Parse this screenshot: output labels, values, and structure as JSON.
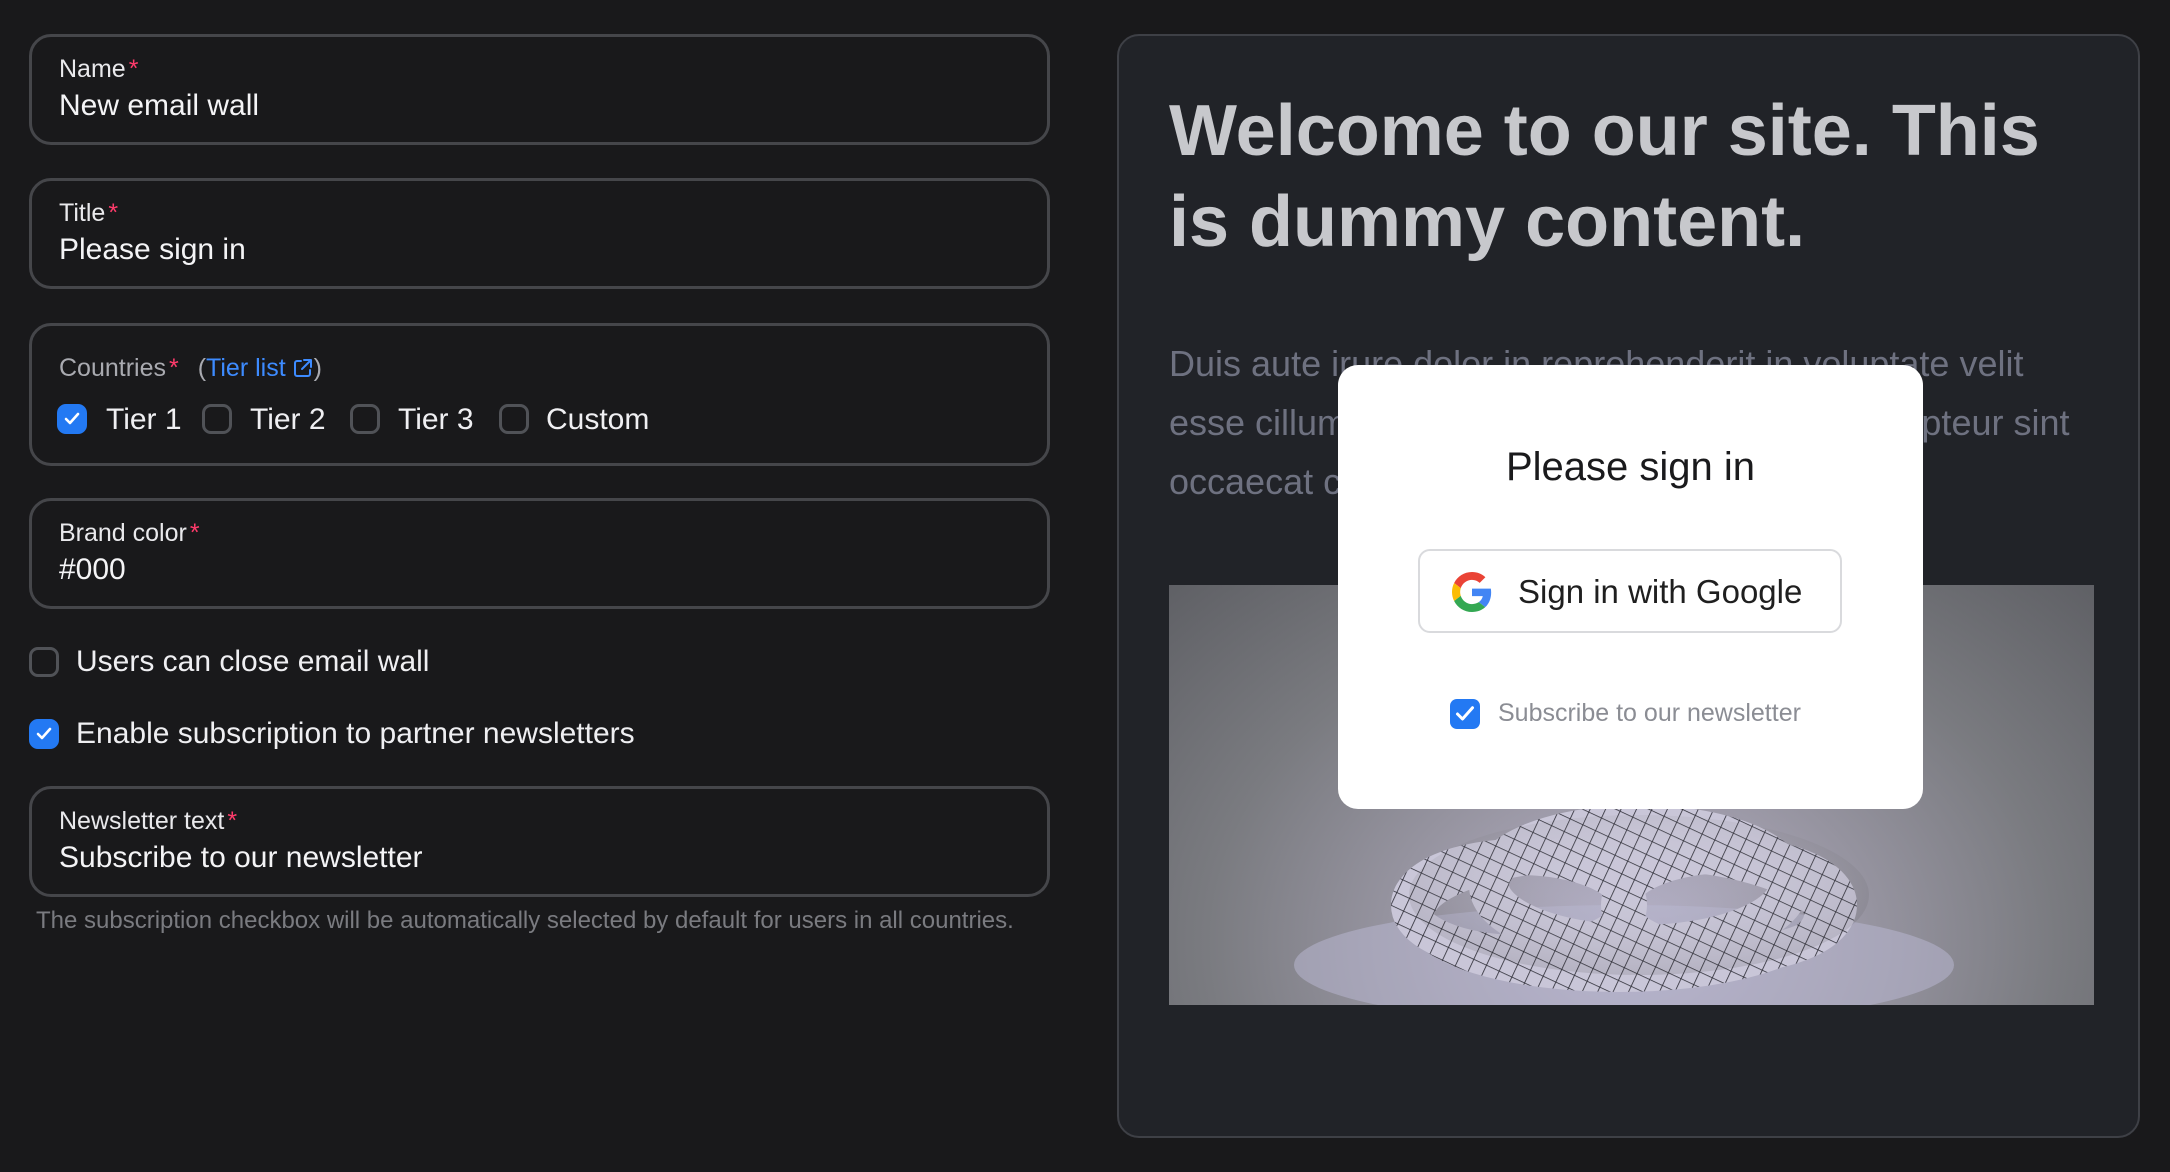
{
  "form": {
    "name": {
      "label": "Name",
      "required_mark": "*",
      "value": "New email wall"
    },
    "title": {
      "label": "Title",
      "required_mark": "*",
      "value": "Please sign in"
    },
    "countries": {
      "label": "Countries",
      "required_mark": "*",
      "link_open": "(",
      "link_text": "Tier list",
      "link_close": ")",
      "options": [
        {
          "label": "Tier 1",
          "checked": true
        },
        {
          "label": "Tier 2",
          "checked": false
        },
        {
          "label": "Tier 3",
          "checked": false
        },
        {
          "label": "Custom",
          "checked": false
        }
      ]
    },
    "brand_color": {
      "label": "Brand color",
      "required_mark": "*",
      "value": "#000"
    },
    "users_can_close": {
      "label": "Users can close email wall",
      "checked": false
    },
    "enable_subscription": {
      "label": "Enable subscription to partner newsletters",
      "checked": true
    },
    "newsletter_text": {
      "label": "Newsletter text",
      "required_mark": "*",
      "value": "Subscribe to our newsletter"
    },
    "helper_text": "The subscription checkbox will be automatically selected by default for users in all countries."
  },
  "preview": {
    "heading": "Welcome to our site. This is dummy content.",
    "body_text": "Duis aute irure dolor in reprehenderit in voluptate velit esse cillum dolore eu fugiat nulla pariatur. Excepteur sint occaecat cupidatat non proident.",
    "modal": {
      "title": "Please sign in",
      "google_button": "Sign in with Google",
      "newsletter_checkbox": {
        "label": "Subscribe to our newsletter",
        "checked": true
      }
    }
  },
  "colors": {
    "background": "#19191b",
    "accent": "#2379f3",
    "required": "#ff3b6b",
    "link": "#3d8bff",
    "preview_bg": "#212328"
  }
}
